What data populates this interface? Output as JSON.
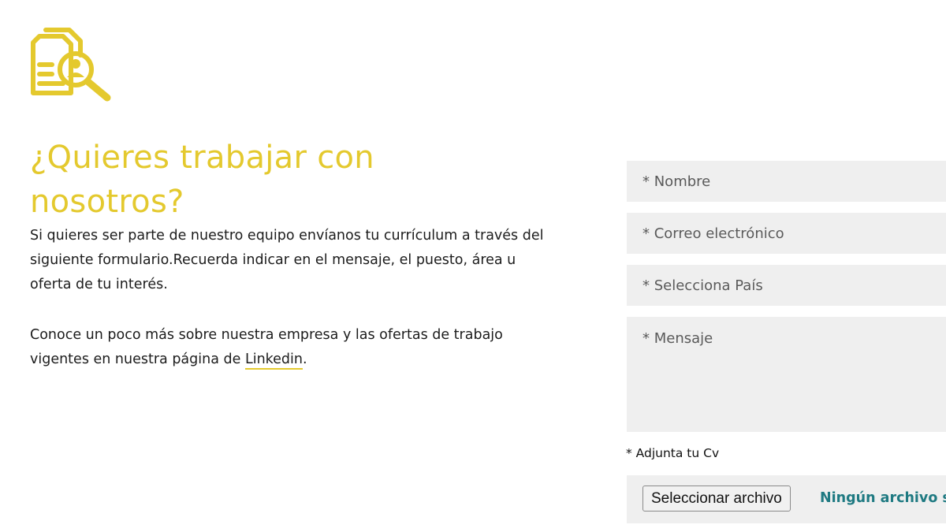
{
  "icon": "resume-search-icon",
  "colors": {
    "accent": "#e4c92e",
    "field_background": "#efefef",
    "file_status": "#1f7a82"
  },
  "heading": "¿Quieres trabajar con nosotros?",
  "intro": {
    "paragraph1": "Si quieres ser parte de nuestro equipo envíanos tu currículum a través del siguiente formulario.Recuerda indicar en el mensaje, el puesto, área u oferta de tu interés.",
    "paragraph2_before": "Conoce un poco más sobre nuestra empresa y las ofertas de trabajo vigentes en nuestra página de ",
    "link_label": "Linkedin",
    "paragraph2_after": "."
  },
  "form": {
    "name_placeholder": "* Nombre",
    "email_placeholder": "* Correo electrónico",
    "country_placeholder": "* Selecciona País",
    "message_placeholder": "* Mensaje",
    "cv_label": "* Adjunta tu Cv",
    "file_button_label": "Seleccionar archivo",
    "file_status": "Ningún archivo seleccionado"
  }
}
